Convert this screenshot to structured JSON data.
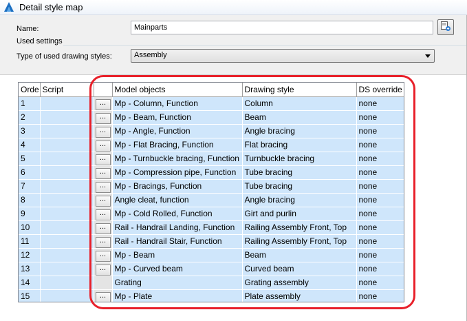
{
  "window": {
    "title": "Detail style map"
  },
  "form": {
    "name_label": "Name:",
    "name_value": "Mainparts",
    "used_settings_label": "Used settings",
    "type_label": "Type of used drawing styles:",
    "type_value": "Assembly"
  },
  "grid": {
    "columns": {
      "order": "Orde",
      "script": "Script",
      "model_objects": "Model objects",
      "drawing_style": "Drawing style",
      "ds_override": "DS override"
    },
    "button_label": "...",
    "rows": [
      {
        "order": "1",
        "button": true,
        "model_objects": "Mp - Column, Function",
        "drawing_style": "Column",
        "ds_override": "none"
      },
      {
        "order": "2",
        "button": true,
        "model_objects": "Mp - Beam, Function",
        "drawing_style": "Beam",
        "ds_override": "none"
      },
      {
        "order": "3",
        "button": true,
        "model_objects": "Mp - Angle, Function",
        "drawing_style": "Angle bracing",
        "ds_override": "none"
      },
      {
        "order": "4",
        "button": true,
        "model_objects": "Mp - Flat Bracing, Function",
        "drawing_style": "Flat bracing",
        "ds_override": "none"
      },
      {
        "order": "5",
        "button": true,
        "model_objects": "Mp - Turnbuckle bracing, Function",
        "drawing_style": "Turnbuckle bracing",
        "ds_override": "none"
      },
      {
        "order": "6",
        "button": true,
        "model_objects": "Mp - Compression pipe, Function",
        "drawing_style": "Tube bracing",
        "ds_override": "none"
      },
      {
        "order": "7",
        "button": true,
        "model_objects": "Mp - Bracings, Function",
        "drawing_style": "Tube bracing",
        "ds_override": "none"
      },
      {
        "order": "8",
        "button": true,
        "model_objects": "Angle cleat, function",
        "drawing_style": "Angle bracing",
        "ds_override": "none"
      },
      {
        "order": "9",
        "button": true,
        "model_objects": "Mp - Cold Rolled, Function",
        "drawing_style": "Girt and purlin",
        "ds_override": "none"
      },
      {
        "order": "10",
        "button": true,
        "model_objects": "Rail - Handrail Landing, Function",
        "drawing_style": "Railing Assembly Front, Top",
        "ds_override": "none"
      },
      {
        "order": "11",
        "button": true,
        "model_objects": "Rail - Handrail Stair, Function",
        "drawing_style": "Railing Assembly Front, Top",
        "ds_override": "none"
      },
      {
        "order": "12",
        "button": true,
        "model_objects": "Mp - Beam",
        "drawing_style": "Beam",
        "ds_override": "none"
      },
      {
        "order": "13",
        "button": true,
        "model_objects": "Mp - Curved beam",
        "drawing_style": "Curved beam",
        "ds_override": "none"
      },
      {
        "order": "14",
        "button": false,
        "model_objects": "Grating",
        "drawing_style": "Grating assembly",
        "ds_override": "none"
      },
      {
        "order": "15",
        "button": true,
        "model_objects": "Mp - Plate",
        "drawing_style": "Plate assembly",
        "ds_override": "none"
      }
    ]
  },
  "colors": {
    "row_fill": "#cfe6fb",
    "highlight": "#e8202a"
  },
  "icons": {
    "app": "app-logo-icon",
    "pick": "pick-object-icon"
  }
}
